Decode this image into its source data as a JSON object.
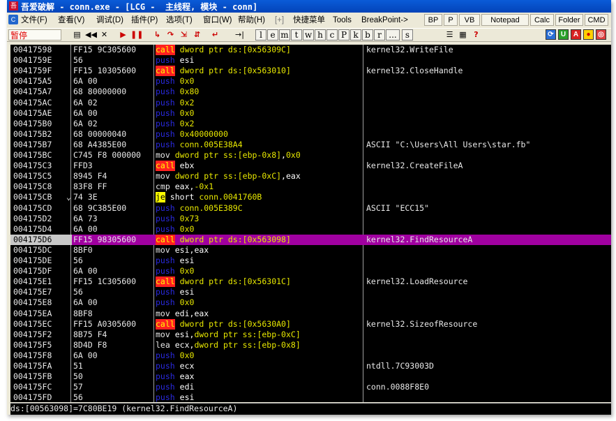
{
  "window": {
    "title": "吾爱破解 - conn.exe - [LCG -  主线程, 模块 - conn]",
    "title_icon_text": "吾"
  },
  "menubar": {
    "items": [
      "文件(F)",
      "查看(V)",
      "调试(D)",
      "插件(P)",
      "选项(T)",
      "窗口(W)",
      "帮助(H)",
      "[+]",
      "快捷菜单",
      "Tools",
      "BreakPoint->"
    ],
    "buttons": [
      "BP",
      "P",
      "VB",
      "Notepad",
      "Calc",
      "Folder",
      "CMD"
    ]
  },
  "toolbar": {
    "status": "暂停",
    "controls": [
      "open",
      "rewind",
      "close",
      "run",
      "pause",
      "step-into",
      "step-over",
      "trace-into",
      "trace-over",
      "execute-till-return",
      "goto-address"
    ],
    "letter_buttons": [
      "l",
      "e",
      "m",
      "t",
      "w",
      "h",
      "c",
      "P",
      "k",
      "b",
      "r",
      "...",
      "s"
    ],
    "extra": [
      "list",
      "grid",
      "?"
    ]
  },
  "rows": [
    {
      "addr": "00417598",
      "mark": "",
      "hex": "FF15 9C305600",
      "op": "call",
      "args": "dword ptr ds:[0x56309C]",
      "cmt": "kernel32.WriteFile"
    },
    {
      "addr": "0041759E",
      "mark": "",
      "hex": "56",
      "op": "push",
      "args": "esi",
      "cmt": ""
    },
    {
      "addr": "0041759F",
      "mark": "",
      "hex": "FF15 10305600",
      "op": "call",
      "args": "dword ptr ds:[0x563010]",
      "cmt": "kernel32.CloseHandle"
    },
    {
      "addr": "004175A5",
      "mark": "",
      "hex": "6A 00",
      "op": "push",
      "args": "0x0",
      "cmt": ""
    },
    {
      "addr": "004175A7",
      "mark": "",
      "hex": "68 80000000",
      "op": "push",
      "args": "0x80",
      "cmt": ""
    },
    {
      "addr": "004175AC",
      "mark": "",
      "hex": "6A 02",
      "op": "push",
      "args": "0x2",
      "cmt": ""
    },
    {
      "addr": "004175AE",
      "mark": "",
      "hex": "6A 00",
      "op": "push",
      "args": "0x0",
      "cmt": ""
    },
    {
      "addr": "004175B0",
      "mark": "",
      "hex": "6A 02",
      "op": "push",
      "args": "0x2",
      "cmt": ""
    },
    {
      "addr": "004175B2",
      "mark": "",
      "hex": "68 00000040",
      "op": "push",
      "args": "0x40000000",
      "cmt": ""
    },
    {
      "addr": "004175B7",
      "mark": "",
      "hex": "68 A4385E00",
      "op": "push",
      "args": "conn.005E38A4",
      "cmt": "ASCII \"C:\\Users\\All Users\\star.fb\""
    },
    {
      "addr": "004175BC",
      "mark": "",
      "hex": "C745 F8 000000",
      "op": "mov",
      "args": "dword ptr ss:[ebp-0x8],0x0",
      "cmt": ""
    },
    {
      "addr": "004175C3",
      "mark": "",
      "hex": "FFD3",
      "op": "call",
      "args": "ebx",
      "cmt": "kernel32.CreateFileA"
    },
    {
      "addr": "004175C5",
      "mark": "",
      "hex": "8945 F4",
      "op": "mov",
      "args": "dword ptr ss:[ebp-0xC],eax",
      "cmt": ""
    },
    {
      "addr": "004175C8",
      "mark": "",
      "hex": "83F8 FF",
      "op": "cmp",
      "args": "eax,-0x1",
      "cmt": ""
    },
    {
      "addr": "004175CB",
      "mark": "⌄",
      "hex": "74 3E",
      "op": "je",
      "args": "short conn.0041760B",
      "cmt": ""
    },
    {
      "addr": "004175CD",
      "mark": "",
      "hex": "68 9C385E00",
      "op": "push",
      "args": "conn.005E389C",
      "cmt": "ASCII \"ECC15\""
    },
    {
      "addr": "004175D2",
      "mark": "",
      "hex": "6A 73",
      "op": "push",
      "args": "0x73",
      "cmt": ""
    },
    {
      "addr": "004175D4",
      "mark": "",
      "hex": "6A 00",
      "op": "push",
      "args": "0x0",
      "cmt": ""
    },
    {
      "addr": "004175D6",
      "mark": "",
      "hex": "FF15 98305600",
      "op": "call",
      "args": "dword ptr ds:[0x563098]",
      "cmt": "kernel32.FindResourceA",
      "selected": true
    },
    {
      "addr": "004175DC",
      "mark": "",
      "hex": "8BF0",
      "op": "mov",
      "args": "esi,eax",
      "cmt": ""
    },
    {
      "addr": "004175DE",
      "mark": "",
      "hex": "56",
      "op": "push",
      "args": "esi",
      "cmt": ""
    },
    {
      "addr": "004175DF",
      "mark": "",
      "hex": "6A 00",
      "op": "push",
      "args": "0x0",
      "cmt": ""
    },
    {
      "addr": "004175E1",
      "mark": "",
      "hex": "FF15 1C305600",
      "op": "call",
      "args": "dword ptr ds:[0x56301C]",
      "cmt": "kernel32.LoadResource"
    },
    {
      "addr": "004175E7",
      "mark": "",
      "hex": "56",
      "op": "push",
      "args": "esi",
      "cmt": ""
    },
    {
      "addr": "004175E8",
      "mark": "",
      "hex": "6A 00",
      "op": "push",
      "args": "0x0",
      "cmt": ""
    },
    {
      "addr": "004175EA",
      "mark": "",
      "hex": "8BF8",
      "op": "mov",
      "args": "edi,eax",
      "cmt": ""
    },
    {
      "addr": "004175EC",
      "mark": "",
      "hex": "FF15 A0305600",
      "op": "call",
      "args": "dword ptr ds:[0x5630A0]",
      "cmt": "kernel32.SizeofResource"
    },
    {
      "addr": "004175F2",
      "mark": "",
      "hex": "8B75 F4",
      "op": "mov",
      "args": "esi,dword ptr ss:[ebp-0xC]",
      "cmt": ""
    },
    {
      "addr": "004175F5",
      "mark": "",
      "hex": "8D4D F8",
      "op": "lea",
      "args": "ecx,dword ptr ss:[ebp-0x8]",
      "cmt": ""
    },
    {
      "addr": "004175F8",
      "mark": "",
      "hex": "6A 00",
      "op": "push",
      "args": "0x0",
      "cmt": ""
    },
    {
      "addr": "004175FA",
      "mark": "",
      "hex": "51",
      "op": "push",
      "args": "ecx",
      "cmt": "ntdll.7C93003D"
    },
    {
      "addr": "004175FB",
      "mark": "",
      "hex": "50",
      "op": "push",
      "args": "eax",
      "cmt": ""
    },
    {
      "addr": "004175FC",
      "mark": "",
      "hex": "57",
      "op": "push",
      "args": "edi",
      "cmt": "conn.0088F8E0"
    },
    {
      "addr": "004175FD",
      "mark": "",
      "hex": "56",
      "op": "push",
      "args": "esi",
      "cmt": ""
    }
  ],
  "infobar": "ds:[00563098]=7C80BE19 (kernel32.FindResourceA)",
  "colors": {
    "background": "#000000",
    "selection": "#a000a0",
    "call_bg": "#ff2020",
    "call_fg": "#ffff00",
    "push_fg": "#2a2adf",
    "operand": "#e8e800"
  }
}
